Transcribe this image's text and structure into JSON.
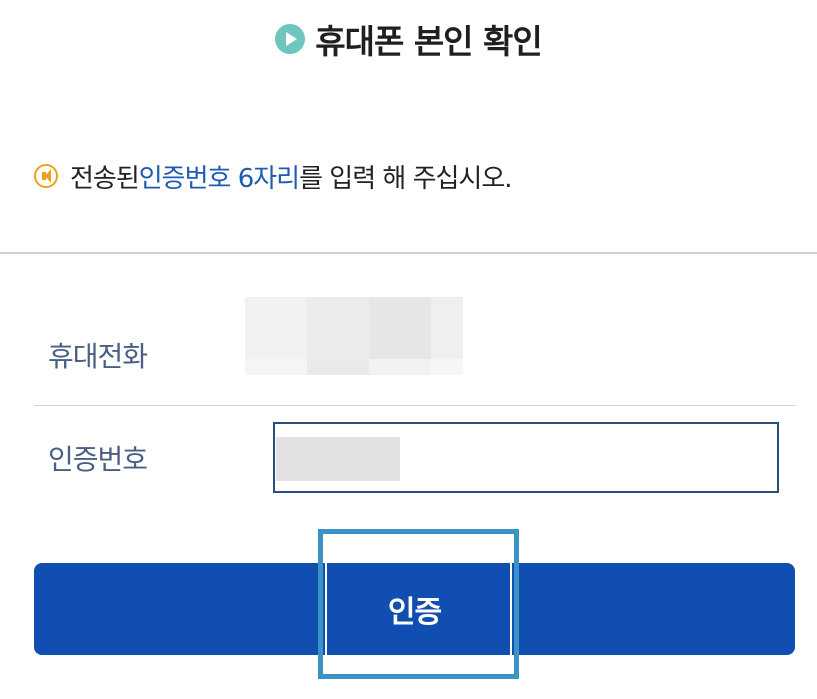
{
  "header": {
    "title": "휴대폰 본인 확인",
    "icon": "play-circle-icon",
    "icon_color": "#6fc6bf"
  },
  "notice": {
    "icon": "speaker-icon",
    "text_before": "전송된 ",
    "highlight": "인증번호 6자리",
    "text_after": "를 입력 해 주십시오.",
    "highlight_color": "#1f5bb3"
  },
  "form": {
    "phone_label": "휴대전화",
    "code_label": "인증번호",
    "code_value": ""
  },
  "actions": {
    "submit_label": "인증",
    "button_color": "#104fb1"
  }
}
